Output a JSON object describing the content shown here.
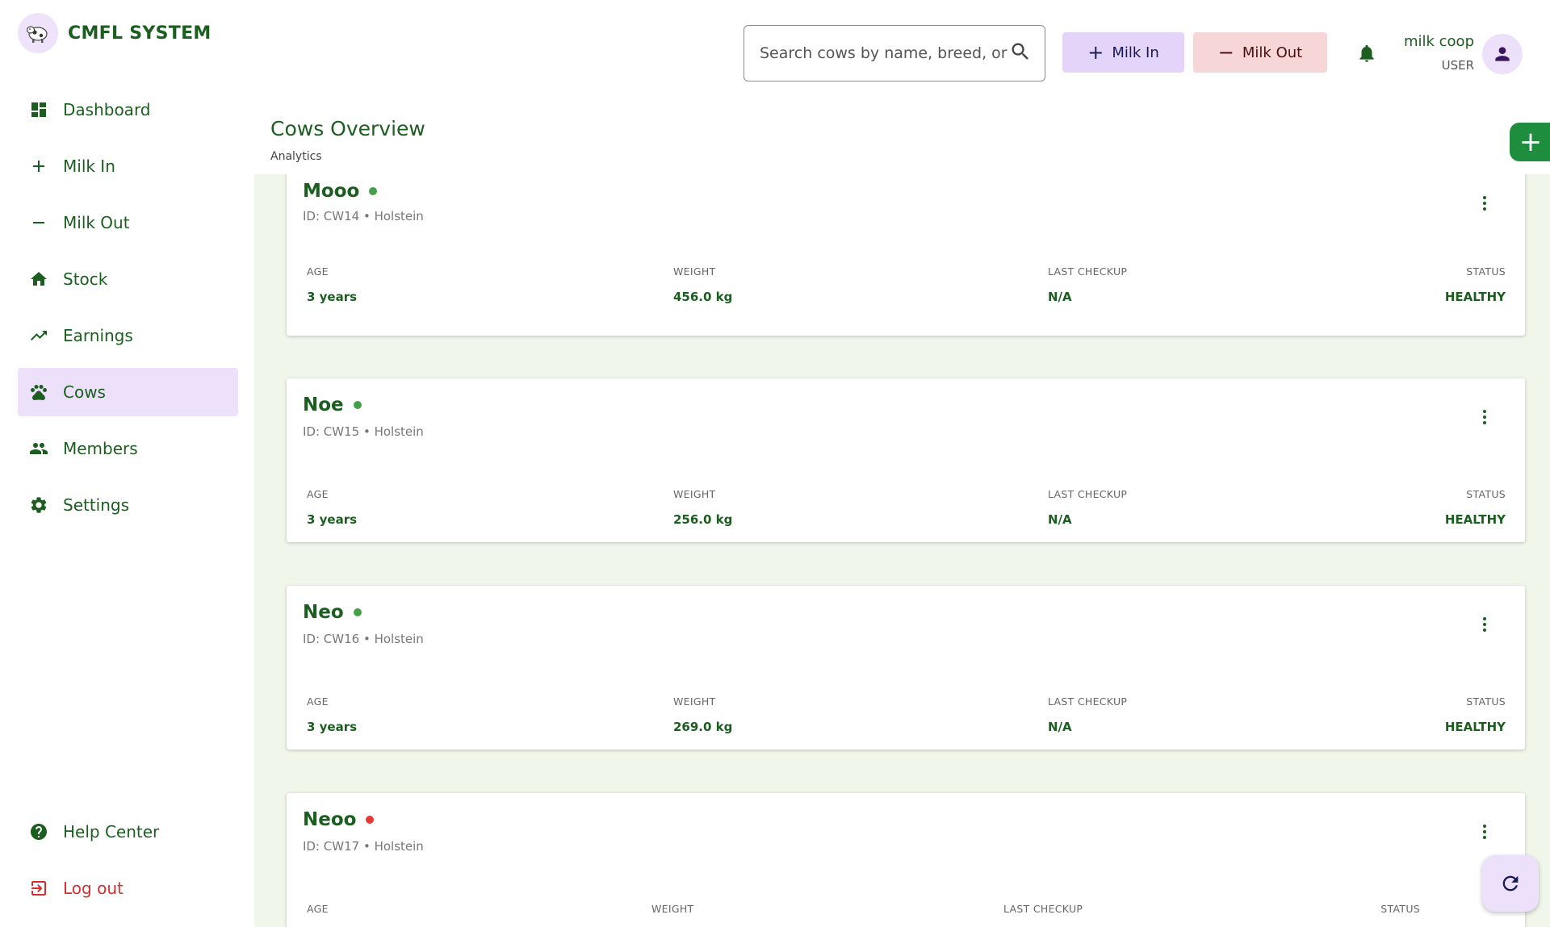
{
  "brand": {
    "title": "CMFL SYSTEM",
    "logo_icon": "cow-icon"
  },
  "sidebar": {
    "items": [
      {
        "label": "Dashboard",
        "icon": "dashboard-icon"
      },
      {
        "label": "Milk In",
        "icon": "plus-icon"
      },
      {
        "label": "Milk Out",
        "icon": "minus-icon"
      },
      {
        "label": "Stock",
        "icon": "home-icon"
      },
      {
        "label": "Earnings",
        "icon": "trending-up-icon"
      },
      {
        "label": "Cows",
        "icon": "paw-icon",
        "active": true
      },
      {
        "label": "Members",
        "icon": "people-icon"
      },
      {
        "label": "Settings",
        "icon": "gear-icon"
      }
    ],
    "bottom": [
      {
        "label": "Help Center",
        "icon": "help-icon"
      },
      {
        "label": "Log out",
        "icon": "logout-icon"
      }
    ]
  },
  "header": {
    "search_placeholder": "Search cows by name, breed, or ID...",
    "milk_in_label": "Milk In",
    "milk_out_label": "Milk Out",
    "user_name": "milk coop",
    "user_role": "USER"
  },
  "page": {
    "title": "Cows Overview",
    "subtitle": "Analytics"
  },
  "columns": {
    "age": "AGE",
    "weight": "WEIGHT",
    "last_checkup": "LAST CHECKUP",
    "status": "STATUS"
  },
  "cows": [
    {
      "name": "Mooo",
      "meta": "ID: CW14 • Holstein",
      "age": "3 years",
      "weight": "456.0 kg",
      "last_checkup": "N/A",
      "status": "HEALTHY",
      "dot_color": "#43a047"
    },
    {
      "name": "Noe",
      "meta": "ID: CW15 • Holstein",
      "age": "3 years",
      "weight": "256.0 kg",
      "last_checkup": "N/A",
      "status": "HEALTHY",
      "dot_color": "#43a047"
    },
    {
      "name": "Neo",
      "meta": "ID: CW16 • Holstein",
      "age": "3 years",
      "weight": "269.0 kg",
      "last_checkup": "N/A",
      "status": "HEALTHY",
      "dot_color": "#43a047"
    },
    {
      "name": "Neoo",
      "meta": "ID: CW17 • Holstein",
      "dot_color": "#e53935"
    }
  ],
  "colors": {
    "primary": "#1b5e20",
    "accent_purple": "#ece0fb",
    "danger": "#d32f2f",
    "content_bg": "#f0f6ea"
  }
}
